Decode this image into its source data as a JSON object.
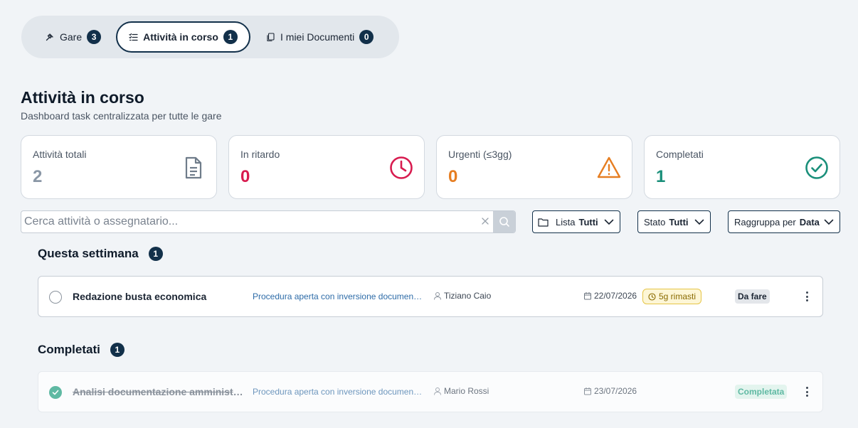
{
  "tabs": [
    {
      "label": "Gare",
      "count": "3",
      "icon": "gavel-icon"
    },
    {
      "label": "Attività in corso",
      "count": "1",
      "icon": "checklist-icon",
      "active": true
    },
    {
      "label": "I miei Documenti",
      "count": "0",
      "icon": "copy-icon"
    }
  ],
  "header": {
    "title": "Attività in corso",
    "subtitle": "Dashboard task centralizzata per tutte le gare"
  },
  "stats": [
    {
      "label": "Attività totali",
      "value": "2",
      "color": "#8a97a6",
      "icon": "document-icon"
    },
    {
      "label": "In ritardo",
      "value": "0",
      "color": "#d81b4f",
      "icon": "clock-icon"
    },
    {
      "label": "Urgenti (≤3gg)",
      "value": "0",
      "color": "#e67e22",
      "icon": "warning-icon"
    },
    {
      "label": "Completati",
      "value": "1",
      "color": "#1a8f7a",
      "icon": "check-circle-icon"
    }
  ],
  "search": {
    "placeholder": "Cerca attività o assegnatario...",
    "value": ""
  },
  "filters": {
    "lista": {
      "label": "Lista",
      "value": "Tutti"
    },
    "stato": {
      "label": "Stato",
      "value": "Tutti"
    },
    "raggruppa": {
      "label": "Raggruppa per",
      "value": "Data"
    }
  },
  "sections": [
    {
      "title": "Questa settimana",
      "count": "1",
      "tasks": [
        {
          "name": "Redazione busta economica",
          "procedure": "Procedura aperta con inversione documentale",
          "assignee": "Tiziano Caio",
          "date": "22/07/2026",
          "remaining": "5g rimasti",
          "status": "Da fare"
        }
      ]
    },
    {
      "title": "Completati",
      "count": "1",
      "tasks": [
        {
          "name": "Analisi documentazione amministrativa",
          "procedure": "Procedura aperta con inversione documentale",
          "assignee": "Mario Rossi",
          "date": "23/07/2026",
          "status": "Completata"
        }
      ]
    }
  ]
}
